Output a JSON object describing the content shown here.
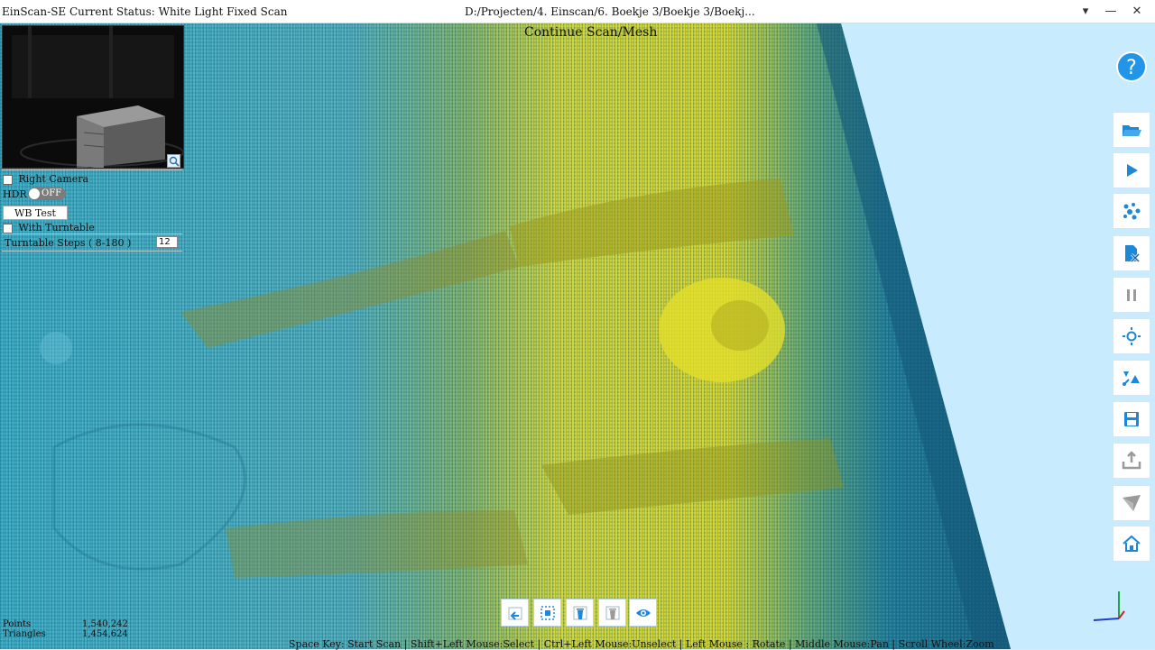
{
  "titlebar": {
    "app_title": "EinScan-SE Current Status: White Light Fixed Scan",
    "file_path": "D:/Projecten/4. Einscan/6. Boekje 3/Boekje 3/Boekj...",
    "dropdown_glyph": "▾",
    "minimize_glyph": "—",
    "close_glyph": "✕"
  },
  "viewport": {
    "continue_label": "Continue Scan/Mesh"
  },
  "controls": {
    "right_camera_label": "Right Camera",
    "hdr_label": "HDR",
    "hdr_toggle_label": "OFF",
    "wb_test_label": "WB Test",
    "with_turntable_label": "With Turntable",
    "turntable_steps_label": "Turntable Steps ( 8-180 )",
    "turntable_steps_value": "12"
  },
  "toolbar": {
    "help_label": "?",
    "items": [
      {
        "icon": "folder-open-icon"
      },
      {
        "icon": "play-icon"
      },
      {
        "icon": "point-cloud-icon"
      },
      {
        "icon": "delete-scan-icon"
      },
      {
        "icon": "pause-icon"
      },
      {
        "icon": "brightness-icon"
      },
      {
        "icon": "align-icon"
      },
      {
        "icon": "save-icon"
      },
      {
        "icon": "export-icon"
      },
      {
        "icon": "measure-icon"
      },
      {
        "icon": "home-icon"
      }
    ]
  },
  "bottom_toolbar": {
    "items": [
      {
        "icon": "undo-icon"
      },
      {
        "icon": "select-region-icon"
      },
      {
        "icon": "delete-selection-icon"
      },
      {
        "icon": "clear-icon"
      },
      {
        "icon": "visibility-icon"
      }
    ]
  },
  "stats": {
    "points_label": "Points",
    "points_value": "1,540,242",
    "triangles_label": "Triangles",
    "triangles_value": "1,454,624"
  },
  "hint": "Space Key: Start Scan | Shift+Left Mouse:Select | Ctrl+Left Mouse:Unselect | Left Mouse : Rotate | Middle Mouse:Pan | Scroll Wheel:Zoom",
  "colors": {
    "accent": "#2196e8",
    "background": "#c8ecfd",
    "mesh_cyan": "#2c9ab5",
    "mesh_yellow": "#d8d629",
    "mesh_dark": "#1f6c8a"
  }
}
